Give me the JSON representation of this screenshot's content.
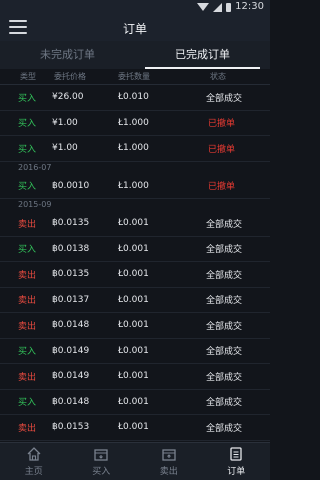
{
  "status_bar": {
    "time": "12:30"
  },
  "header": {
    "title": "订单"
  },
  "tabs": [
    {
      "label": "未完成订单",
      "active": false
    },
    {
      "label": "已完成订单",
      "active": true
    }
  ],
  "columns": {
    "type": "类型",
    "price": "委托价格",
    "amount": "委托数量",
    "status": "状态"
  },
  "orders": [
    {
      "kind": "row",
      "type": "买入",
      "side": "buy",
      "price": "¥26.00",
      "amount": "Ł0.010",
      "status": "全部成交",
      "status_kind": "done"
    },
    {
      "kind": "row",
      "type": "买入",
      "side": "buy",
      "price": "¥1.00",
      "amount": "Ł1.000",
      "status": "已撤单",
      "status_kind": "cancel"
    },
    {
      "kind": "row",
      "type": "买入",
      "side": "buy",
      "price": "¥1.00",
      "amount": "Ł1.000",
      "status": "已撤单",
      "status_kind": "cancel"
    },
    {
      "kind": "section",
      "label": "2016-07"
    },
    {
      "kind": "row",
      "type": "买入",
      "side": "buy",
      "price": "฿0.0010",
      "amount": "Ł1.000",
      "status": "已撤单",
      "status_kind": "cancel"
    },
    {
      "kind": "section",
      "label": "2015-09"
    },
    {
      "kind": "row",
      "type": "卖出",
      "side": "sell",
      "price": "฿0.0135",
      "amount": "Ł0.001",
      "status": "全部成交",
      "status_kind": "done"
    },
    {
      "kind": "row",
      "type": "买入",
      "side": "buy",
      "price": "฿0.0138",
      "amount": "Ł0.001",
      "status": "全部成交",
      "status_kind": "done"
    },
    {
      "kind": "row",
      "type": "卖出",
      "side": "sell",
      "price": "฿0.0135",
      "amount": "Ł0.001",
      "status": "全部成交",
      "status_kind": "done"
    },
    {
      "kind": "row",
      "type": "卖出",
      "side": "sell",
      "price": "฿0.0137",
      "amount": "Ł0.001",
      "status": "全部成交",
      "status_kind": "done"
    },
    {
      "kind": "row",
      "type": "卖出",
      "side": "sell",
      "price": "฿0.0148",
      "amount": "Ł0.001",
      "status": "全部成交",
      "status_kind": "done"
    },
    {
      "kind": "row",
      "type": "买入",
      "side": "buy",
      "price": "฿0.0149",
      "amount": "Ł0.001",
      "status": "全部成交",
      "status_kind": "done"
    },
    {
      "kind": "row",
      "type": "卖出",
      "side": "sell",
      "price": "฿0.0149",
      "amount": "Ł0.001",
      "status": "全部成交",
      "status_kind": "done"
    },
    {
      "kind": "row",
      "type": "买入",
      "side": "buy",
      "price": "฿0.0148",
      "amount": "Ł0.001",
      "status": "全部成交",
      "status_kind": "done"
    },
    {
      "kind": "row",
      "type": "卖出",
      "side": "sell",
      "price": "฿0.0153",
      "amount": "Ł0.001",
      "status": "全部成交",
      "status_kind": "done"
    }
  ],
  "tabbar": [
    {
      "label": "主页",
      "icon": "home-icon",
      "active": false
    },
    {
      "label": "买入",
      "icon": "buy-icon",
      "active": false
    },
    {
      "label": "卖出",
      "icon": "sell-icon",
      "active": false
    },
    {
      "label": "订单",
      "icon": "orders-icon",
      "active": true
    }
  ],
  "colors": {
    "buy": "#32c25a",
    "sell": "#e84a3f",
    "cancel": "#e63a32",
    "background": "#12151b",
    "header": "#1c222c"
  }
}
